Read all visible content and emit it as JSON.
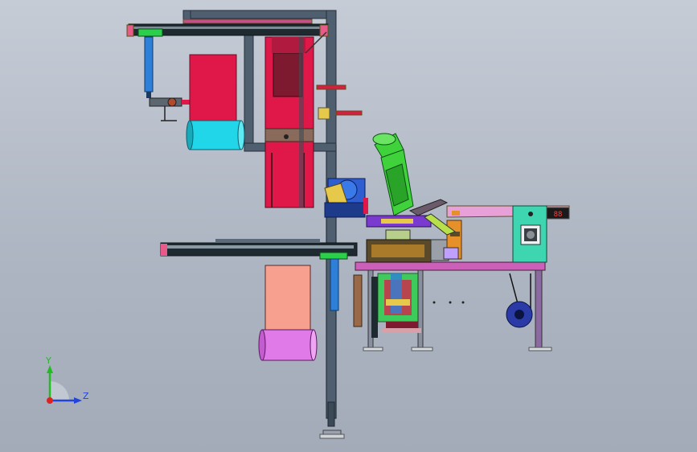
{
  "viewport": {
    "background_top": "#c6ccd6",
    "background_bottom": "#a3abb9"
  },
  "triad": {
    "y_label": "Y",
    "z_label": "Z",
    "y_color": "#22bb22",
    "z_color": "#2244dd",
    "origin_color": "#dd2222"
  },
  "counter_display": {
    "value": "88"
  },
  "palette": {
    "frame": "#4a5a6c",
    "frame_edge": "#2d3945",
    "red_block": "#e0184a",
    "dark_red": "#7e1a30",
    "cyan_roll": "#22d6ea",
    "blue_cylinder": "#2e7fd8",
    "green_motor": "#3fd23a",
    "magenta_rail": "#e07ac8",
    "purple_table": "#cc5fb8",
    "salmon_block": "#f7a090",
    "violet_roll": "#e07ae8",
    "teal_box": "#3ed6b0",
    "yellow_part": "#e6c94a",
    "orange_part": "#e6902a"
  }
}
